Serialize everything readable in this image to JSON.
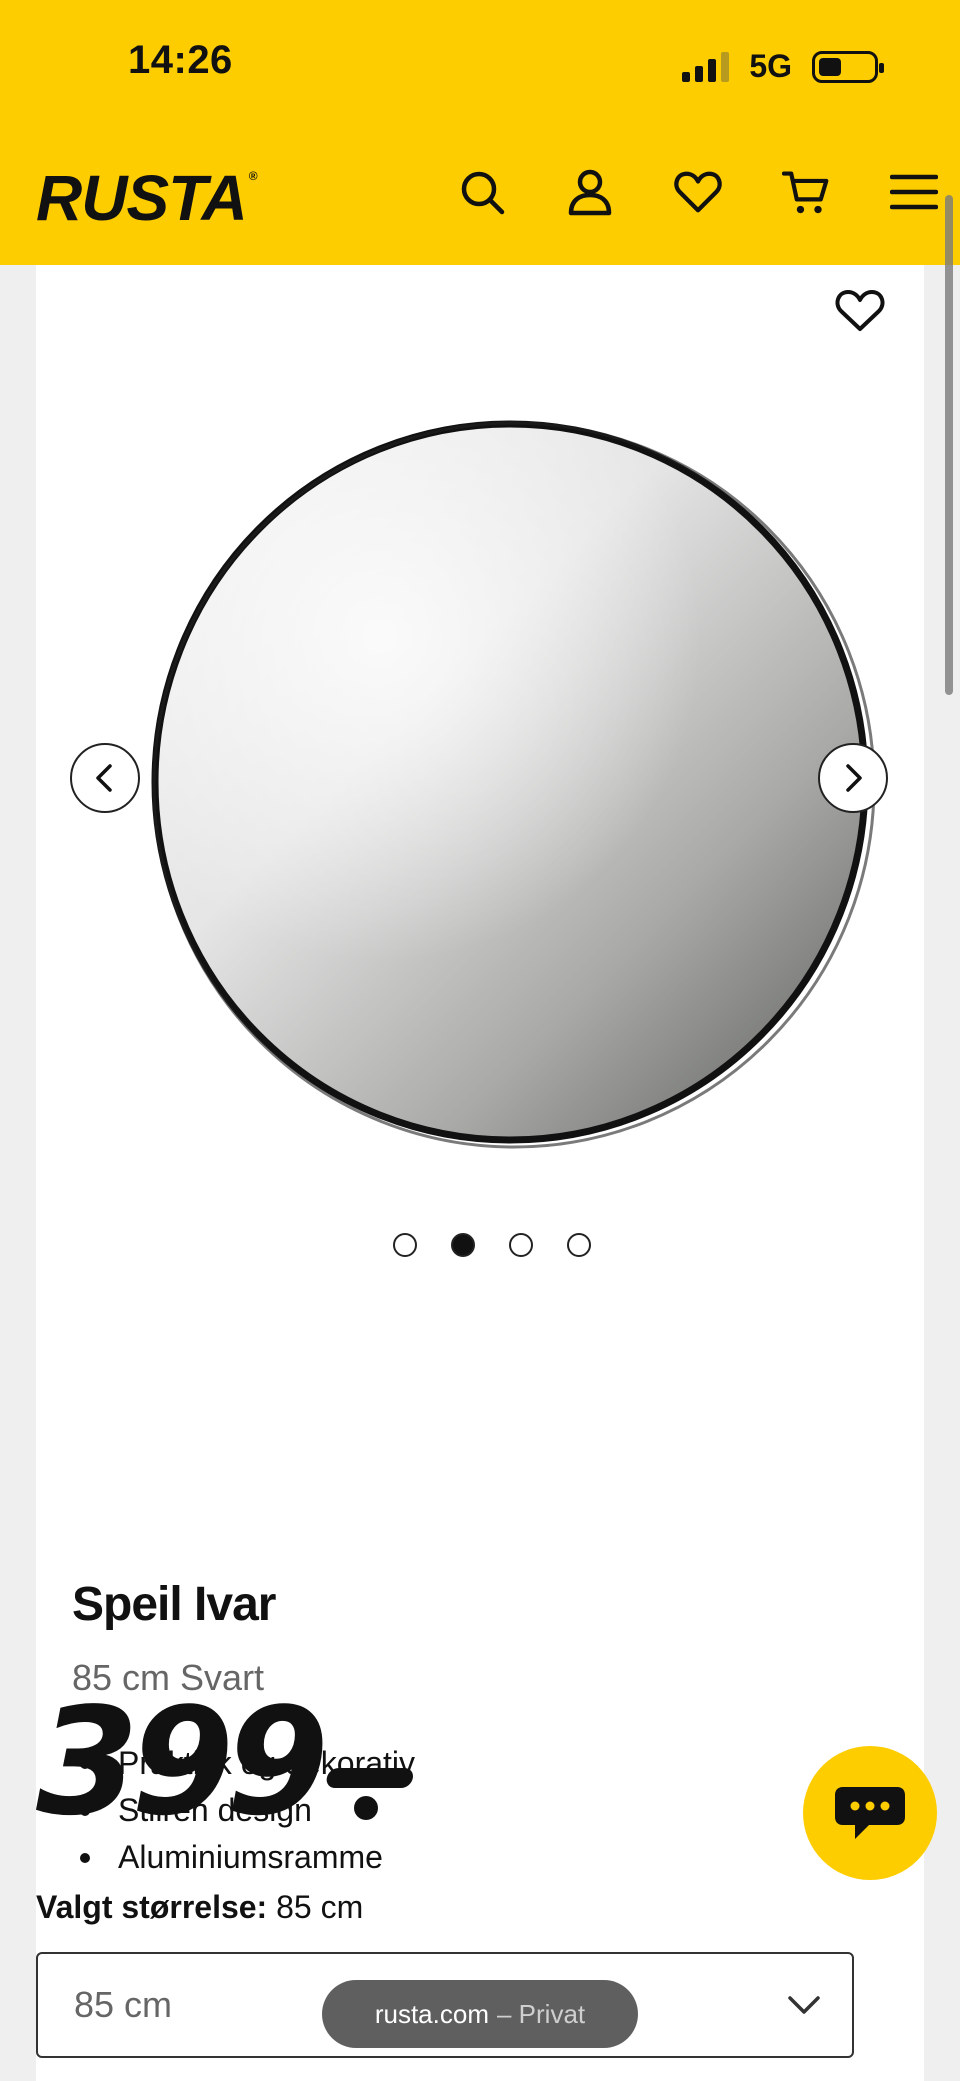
{
  "status_bar": {
    "time": "14:26",
    "network": "5G"
  },
  "header": {
    "logo": "RUSTA",
    "logo_mark": "®",
    "icons": [
      "search-icon",
      "account-icon",
      "heart-icon",
      "cart-icon",
      "menu-icon"
    ]
  },
  "product": {
    "name": "Speil Ivar",
    "variant": "85 cm Svart",
    "features": [
      "Praktisk og dekorativ",
      "Stilren design",
      "Aluminiumsramme"
    ],
    "price": "399",
    "gallery": {
      "image_count": 4,
      "active_index": 1
    }
  },
  "size": {
    "label": "Valgt størrelse:",
    "value": "85 cm",
    "selected": "85 cm"
  },
  "browser": {
    "domain": "rusta.com",
    "mode": "– Privat"
  },
  "colors": {
    "brand_yellow": "#fecd00",
    "text": "#111111",
    "muted": "#666666"
  }
}
